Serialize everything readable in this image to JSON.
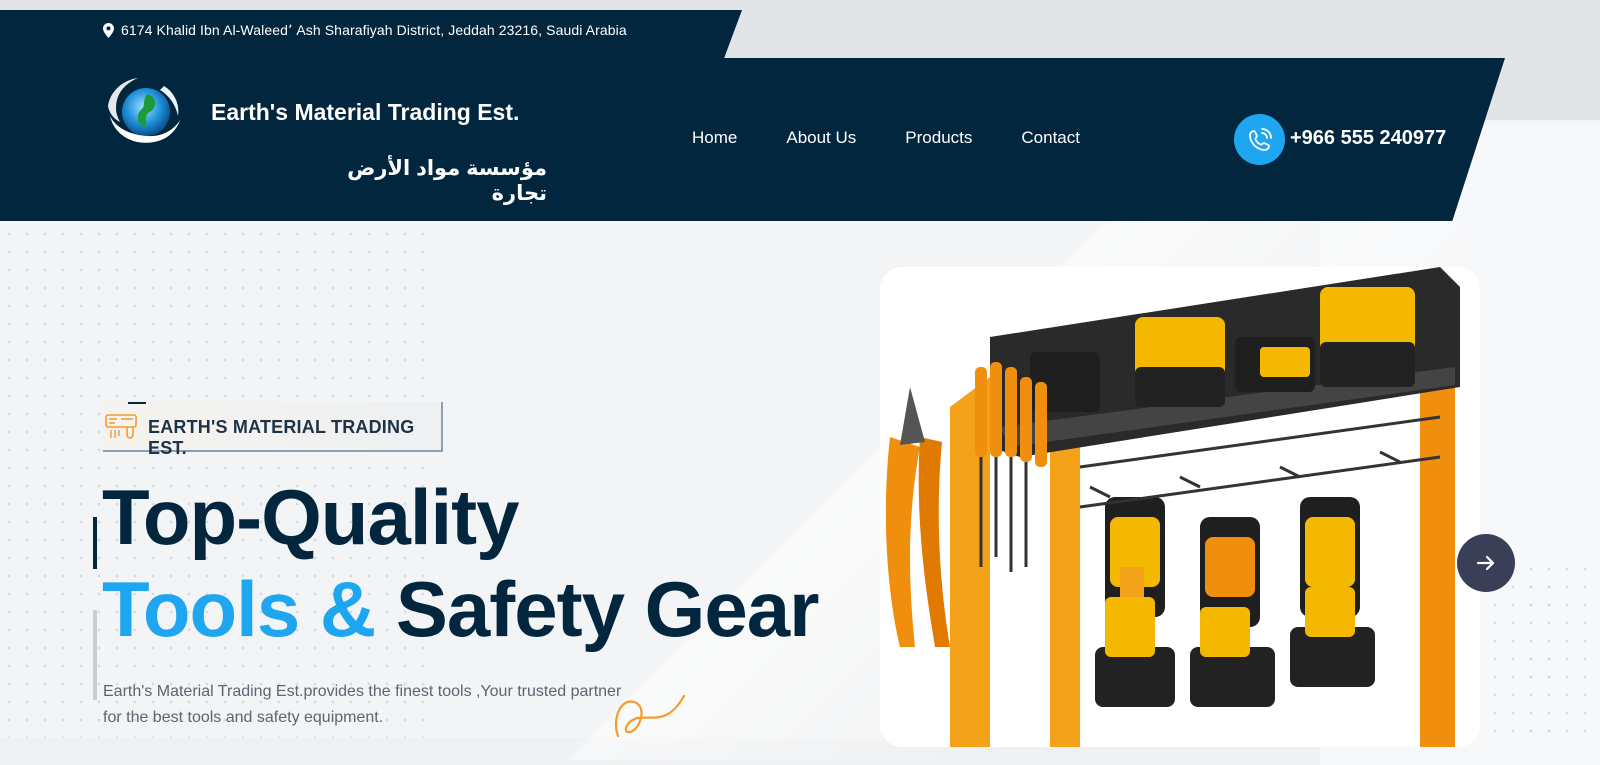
{
  "topbar": {
    "address": "6174 Khalid Ibn Al-Waleed٬ Ash Sharafiyah District, Jeddah 23216, Saudi Arabia",
    "address_icon": "map-pin-icon"
  },
  "header": {
    "brand_en": "Earth's Material Trading Est.",
    "brand_ar": "مؤسسة مواد الأرض تجارة",
    "logo_icon": "globe-logo-icon",
    "nav": [
      "Home",
      "About Us",
      "Products",
      "Contact"
    ],
    "phone": "+966 555 240977",
    "phone_icon": "phone-call-icon"
  },
  "hero": {
    "tagline": "EARTH'S MATERIAL TRADING EST.",
    "tagline_icon": "tools-icon",
    "title_line1": "Top-Quality",
    "title_line2_accent": "Tools &",
    "title_line2_rest": "Safety Gear",
    "description": "Earth's Material Trading Est.provides the finest tools ,Your trusted partner for the best tools and safety equipment.",
    "next_icon": "arrow-right-icon"
  },
  "colors": {
    "navy": "#03263f",
    "accent": "#1ea6f0",
    "orange": "#f59a2c",
    "tool_yellow": "#f5b800"
  }
}
